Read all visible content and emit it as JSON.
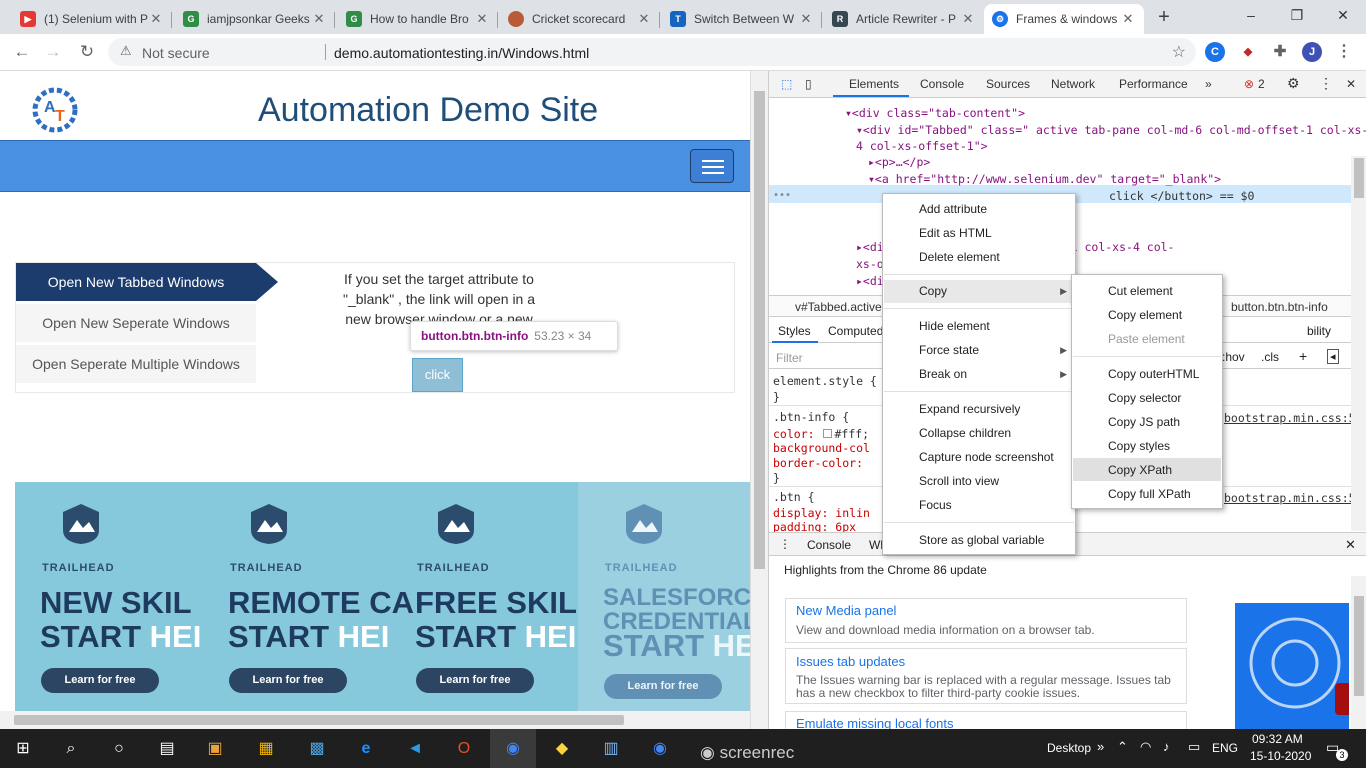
{
  "browser": {
    "tabs": [
      {
        "title": "(1) Selenium with P",
        "favicon_color": "#e53935",
        "active": false
      },
      {
        "title": "iamjpsonkar Geeks",
        "favicon_color": "#2f8d46",
        "active": false
      },
      {
        "title": "How to handle Bro",
        "favicon_color": "#2f8d46",
        "active": false
      },
      {
        "title": "Cricket scorecard",
        "favicon_color": "#b85c38",
        "active": false
      },
      {
        "title": "Switch Between W",
        "favicon_color": "#1565c0",
        "active": false
      },
      {
        "title": "Article Rewriter - P",
        "favicon_color": "#37474f",
        "active": false
      },
      {
        "title": "Frames & windows",
        "favicon_color": "#1a73e8",
        "active": true
      }
    ],
    "new_tab": "+",
    "window_controls": {
      "minimize": "–",
      "restore": "❐",
      "close": "✕"
    },
    "address": {
      "security": "Not secure",
      "url": "demo.automationtesting.in/Windows.html"
    }
  },
  "site": {
    "title": "Automation Demo Site",
    "logo_text": "AT",
    "tabs_menu": [
      "Open New Tabbed Windows",
      "Open New Seperate Windows",
      "Open Seperate Multiple Windows"
    ],
    "description_lines": [
      "If you set the target attribute to",
      "\"_blank\" , the link will open in a",
      "new browser window or a new"
    ],
    "tooltip": {
      "selector": "button.btn.btn-info",
      "size": "53.23 × 34"
    },
    "click_button": "click",
    "banner": [
      {
        "brand": "TRAILHEAD",
        "line1": "NEW SKIL",
        "line2a": "START ",
        "line2b": "HEI",
        "cta": "Learn for free"
      },
      {
        "brand": "TRAILHEAD",
        "line1": "REMOTE CA",
        "line2a": "START ",
        "line2b": "HEI",
        "cta": "Learn for free"
      },
      {
        "brand": "TRAILHEAD",
        "line1": "FREE SKIL",
        "line2a": "START ",
        "line2b": "HEI",
        "cta": "Learn for free"
      },
      {
        "brand": "TRAILHEAD",
        "line1": "SALESFORCE",
        "line1b": "CREDENTIAL",
        "line2a": "START ",
        "line2b": "HE",
        "cta": "Learn for free"
      }
    ]
  },
  "devtools": {
    "tabs": [
      "Elements",
      "Console",
      "Sources",
      "Network",
      "Performance",
      "»"
    ],
    "error_count": "2",
    "dom_lines": [
      "▾<div class=\"tab-content\">",
      "▾<div id=\"Tabbed\" class=\" active tab-pane col-md-6 col-md-offset-1 col-xs-",
      "4 col-xs-offset-1\">",
      "▸<p>…</p>",
      "▾<a href=\"http://www.selenium.dev\" target=\"_blank\">",
      "click  </button> == $0",
      "▸<di                                 ne col-md-6 col-md-offset-1 col-xs-4 col-",
      "xs-o",
      "▸<di                                  set-1 col-xs-4 col-"
    ],
    "breadcrumb": [
      "v#Tabbed.active",
      "button.btn.btn-info"
    ],
    "styles_tabs": [
      "Styles",
      "Computed",
      "bility"
    ],
    "filter_placeholder": "Filter",
    "filter_tools": [
      ":hov",
      ".cls",
      "+"
    ],
    "css_lines": [
      "element.style {",
      "}",
      ".btn-info {",
      "  color: ",
      "#fff;",
      "  background-col",
      "  border-color: ",
      "}",
      ".btn {",
      "  display: inlin",
      "  padding: 6px"
    ],
    "css_sources": [
      "bootstrap.min.css:5",
      "bootstrap.min.css:5"
    ],
    "drawer_tabs": [
      "Console",
      "Wh"
    ],
    "whats_new_header": "Highlights from the Chrome 86 update",
    "whats_new": [
      {
        "title": "New Media panel",
        "desc": "View and download media information on a browser tab."
      },
      {
        "title": "Issues tab updates",
        "desc": "The Issues warning bar is replaced with a regular message. Issues tab has a new checkbox to filter third-party cookie issues."
      },
      {
        "title": "Emulate missing local fonts",
        "desc": ""
      }
    ]
  },
  "context_menu": {
    "items": [
      "Add attribute",
      "Edit as HTML",
      "Delete element",
      "Copy",
      "Hide element",
      "Force state",
      "Break on",
      "Expand recursively",
      "Collapse children",
      "Capture node screenshot",
      "Scroll into view",
      "Focus",
      "Store as global variable"
    ],
    "submenu": [
      "Cut element",
      "Copy element",
      "Paste element",
      "Copy outerHTML",
      "Copy selector",
      "Copy JS path",
      "Copy styles",
      "Copy XPath",
      "Copy full XPath"
    ]
  },
  "taskbar": {
    "desktop_label": "Desktop",
    "language": "ENG",
    "time": "09:32 AM",
    "date": "15-10-2020",
    "notifications": "3",
    "watermark": "screenrec"
  }
}
